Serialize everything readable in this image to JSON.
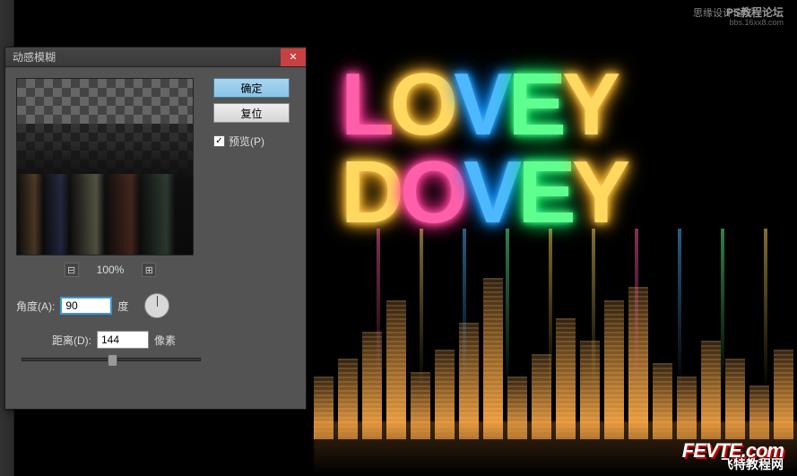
{
  "dialog": {
    "title": "动感模糊",
    "ok_label": "确定",
    "reset_label": "复位",
    "preview_label": "预览(P)",
    "preview_checked": "✓",
    "zoom_out": "⊟",
    "zoom_in": "⊞",
    "zoom_value": "100%",
    "angle_label": "角度(A):",
    "angle_value": "90",
    "angle_unit": "度",
    "distance_label": "距离(D):",
    "distance_value": "144",
    "distance_unit": "像素",
    "close_icon": "✕"
  },
  "neon": {
    "line1": [
      {
        "char": "L",
        "cls": "glow-pink"
      },
      {
        "char": "O",
        "cls": "glow-yellow"
      },
      {
        "char": "V",
        "cls": "glow-blue"
      },
      {
        "char": "E",
        "cls": "glow-green"
      },
      {
        "char": "Y",
        "cls": "glow-yellow"
      }
    ],
    "line2": [
      {
        "char": "D",
        "cls": "glow-yellow"
      },
      {
        "char": "O",
        "cls": "glow-pink"
      },
      {
        "char": "V",
        "cls": "glow-blue"
      },
      {
        "char": "E",
        "cls": "glow-green"
      },
      {
        "char": "Y",
        "cls": "glow-yellow"
      }
    ]
  },
  "watermarks": {
    "w1": "思缘设计论坛",
    "w2": "PS教程论坛",
    "w3": "bbs.16xx8.com",
    "w4": "FEVTE.com",
    "w5": "飞特教程网"
  }
}
